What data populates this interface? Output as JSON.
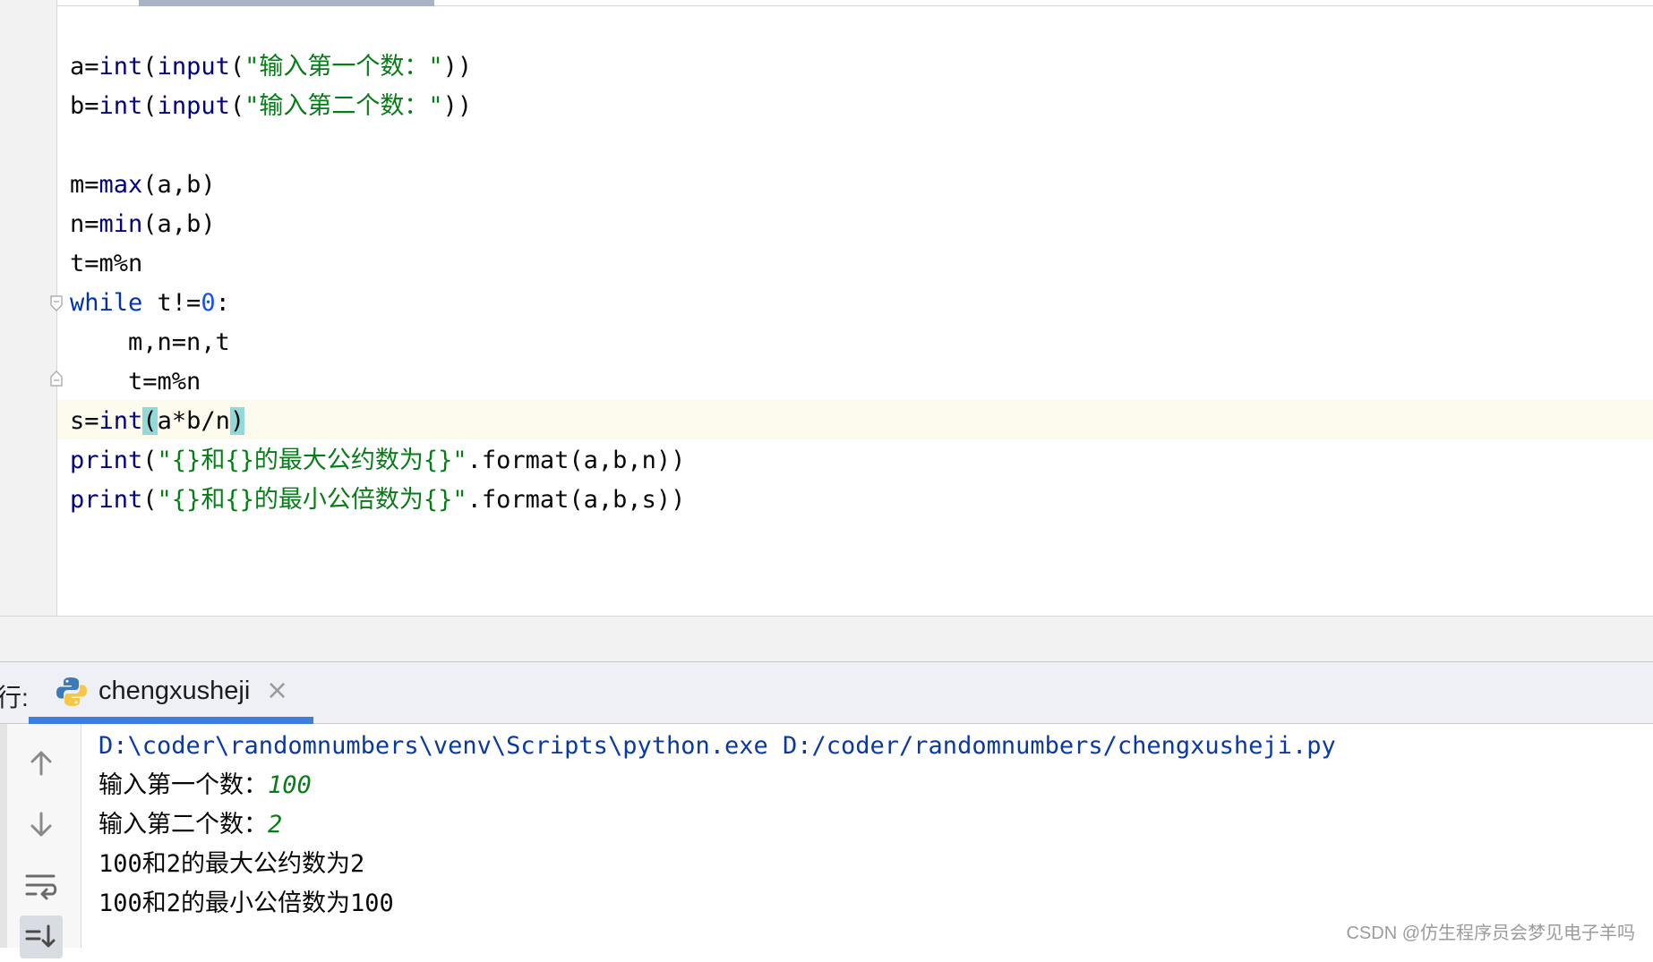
{
  "editor": {
    "lines": [
      {
        "a": "a=",
        "b": "int",
        "c": "(",
        "d": "input",
        "e": "(",
        "f": "\"输入第一个数：\"",
        "g": "))"
      },
      {
        "a": "b=",
        "b": "int",
        "c": "(",
        "d": "input",
        "e": "(",
        "f": "\"输入第二个数：\"",
        "g": "))"
      },
      {
        "a": "m=",
        "b": "max",
        "c": "(a,b)"
      },
      {
        "a": "n=",
        "b": "min",
        "c": "(a,b)"
      },
      {
        "a": "t=m%n"
      },
      {
        "kw": "while",
        "rest": " t!=",
        "num": "0",
        "end": ":"
      },
      {
        "a": "    m,n=n,t"
      },
      {
        "a": "    t=m%n"
      },
      {
        "a": "s=",
        "b": "int",
        "open": "(",
        "mid": "a*b/n",
        "close": ")"
      },
      {
        "fn": "print",
        "p1": "(",
        "str": "\"{}和{}的最大公约数为{}\"",
        "rest": ".format(a,b,n))"
      },
      {
        "fn": "print",
        "p1": "(",
        "str": "\"{}和{}的最小公倍数为{}\"",
        "rest": ".format(a,b,s))"
      }
    ]
  },
  "run": {
    "prefix": "行:",
    "tab_label": "chengxusheji",
    "tab_close": "×",
    "icons": [
      "arrow-up-icon",
      "arrow-down-icon",
      "soft-wrap-icon",
      "scroll-to-end-icon"
    ],
    "console": {
      "command": "D:\\coder\\randomnumbers\\venv\\Scripts\\python.exe D:/coder/randomnumbers/chengxusheji.py",
      "prompt1": "输入第一个数：",
      "input1": "100",
      "prompt2": "输入第二个数：",
      "input2": "2",
      "out1": "100和2的最大公约数为2",
      "out2": "100和2的最小公倍数为100"
    }
  },
  "watermark": "CSDN @仿生程序员会梦见电子羊吗",
  "colors": {
    "keyword": "#0033b3",
    "builtin": "#000080",
    "string": "#067d17",
    "number": "#1750eb",
    "brace_highlight": "#93d9d9",
    "current_line": "#fcfaed",
    "tab_underline": "#3c7ddd"
  }
}
